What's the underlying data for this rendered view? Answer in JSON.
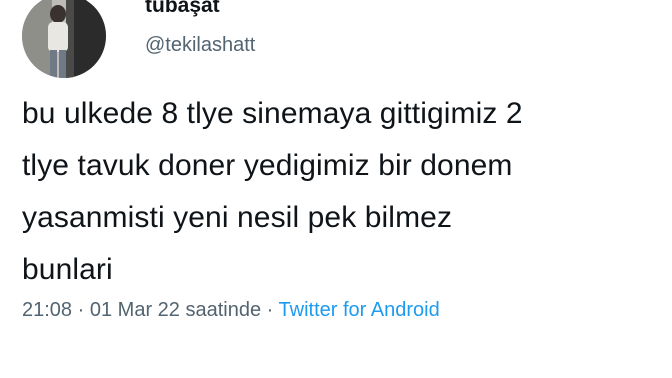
{
  "user": {
    "display_name": "tubaşat",
    "handle": "@tekilashatt"
  },
  "tweet": {
    "text_lines": [
      "bu ulkede 8 tlye sinemaya gittigimiz 2",
      "tlye tavuk doner yedigimiz bir donem",
      "yasanmisti yeni nesil pek bilmez",
      "bunlari"
    ],
    "time": "21:08",
    "separator": "·",
    "date": "01 Mar 22 saatinde",
    "source": "Twitter for Android"
  },
  "colors": {
    "text": "#0f1419",
    "secondary": "#536471",
    "link": "#1d9bf0"
  }
}
